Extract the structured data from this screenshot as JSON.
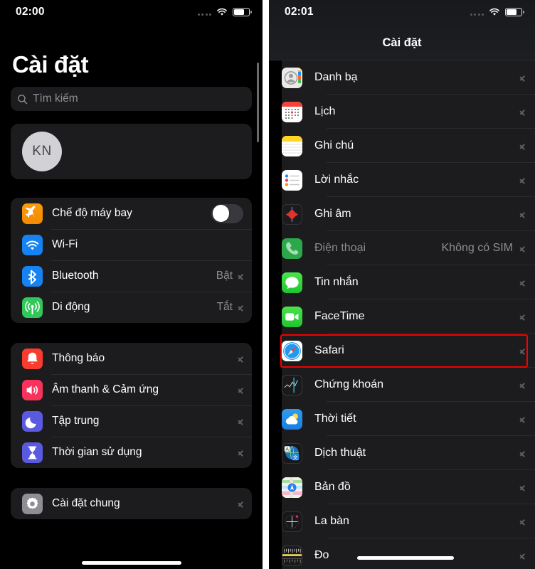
{
  "left": {
    "status": {
      "time": "02:00",
      "icons": [
        "signal-dots-icon",
        "wifi-icon",
        "battery-icon"
      ]
    },
    "title": "Cài đặt",
    "search": {
      "placeholder": "Tìm kiếm",
      "icon": "search-icon"
    },
    "profile": {
      "initials": "KN"
    },
    "groups": [
      {
        "rows": [
          {
            "label": "Chế độ máy bay",
            "icon": "airplane-icon",
            "control": "toggle",
            "toggle_on": false,
            "value": ""
          },
          {
            "label": "Wi-Fi",
            "icon": "wifi-app-icon",
            "control": "none",
            "value": ""
          },
          {
            "label": "Bluetooth",
            "icon": "bluetooth-icon",
            "control": "chevron",
            "value": "Bật"
          },
          {
            "label": "Di động",
            "icon": "cellular-icon",
            "control": "chevron",
            "value": "Tắt"
          }
        ]
      },
      {
        "rows": [
          {
            "label": "Thông báo",
            "icon": "notifications-icon",
            "control": "chevron",
            "value": ""
          },
          {
            "label": "Âm thanh & Cảm ứng",
            "icon": "sounds-haptics-icon",
            "control": "chevron",
            "value": ""
          },
          {
            "label": "Tập trung",
            "icon": "focus-icon",
            "control": "chevron",
            "value": ""
          },
          {
            "label": "Thời gian sử dụng",
            "icon": "screen-time-icon",
            "control": "chevron",
            "value": ""
          }
        ]
      },
      {
        "rows": [
          {
            "label": "Cài đặt chung",
            "icon": "general-gear-icon",
            "control": "chevron",
            "value": ""
          }
        ]
      }
    ]
  },
  "right": {
    "status": {
      "time": "02:01",
      "icons": [
        "signal-dots-icon",
        "wifi-icon",
        "battery-icon"
      ]
    },
    "header_title": "Cài đặt",
    "highlight": {
      "row_label": "Safari",
      "color": "#f40000"
    },
    "rows": [
      {
        "label": "Danh bạ",
        "icon": "contacts-icon",
        "value": "",
        "dim": false,
        "highlighted": false
      },
      {
        "label": "Lịch",
        "icon": "calendar-icon",
        "value": "",
        "dim": false,
        "highlighted": false
      },
      {
        "label": "Ghi chú",
        "icon": "notes-icon",
        "value": "",
        "dim": false,
        "highlighted": false
      },
      {
        "label": "Lời nhắc",
        "icon": "reminders-icon",
        "value": "",
        "dim": false,
        "highlighted": false
      },
      {
        "label": "Ghi âm",
        "icon": "voice-memos-icon",
        "value": "",
        "dim": false,
        "highlighted": false
      },
      {
        "label": "Điện thoại",
        "icon": "phone-icon",
        "value": "Không có SIM",
        "dim": true,
        "highlighted": false
      },
      {
        "label": "Tin nhắn",
        "icon": "messages-icon",
        "value": "",
        "dim": false,
        "highlighted": false
      },
      {
        "label": "FaceTime",
        "icon": "facetime-icon",
        "value": "",
        "dim": false,
        "highlighted": false
      },
      {
        "label": "Safari",
        "icon": "safari-icon",
        "value": "",
        "dim": false,
        "highlighted": true
      },
      {
        "label": "Chứng khoán",
        "icon": "stocks-icon",
        "value": "",
        "dim": false,
        "highlighted": false
      },
      {
        "label": "Thời tiết",
        "icon": "weather-icon",
        "value": "",
        "dim": false,
        "highlighted": false
      },
      {
        "label": "Dịch thuật",
        "icon": "translate-icon",
        "value": "",
        "dim": false,
        "highlighted": false
      },
      {
        "label": "Bản đồ",
        "icon": "maps-icon",
        "value": "",
        "dim": false,
        "highlighted": false
      },
      {
        "label": "La bàn",
        "icon": "compass-icon",
        "value": "",
        "dim": false,
        "highlighted": false
      },
      {
        "label": "Đo",
        "icon": "measure-icon",
        "value": "",
        "dim": false,
        "highlighted": false
      }
    ]
  }
}
